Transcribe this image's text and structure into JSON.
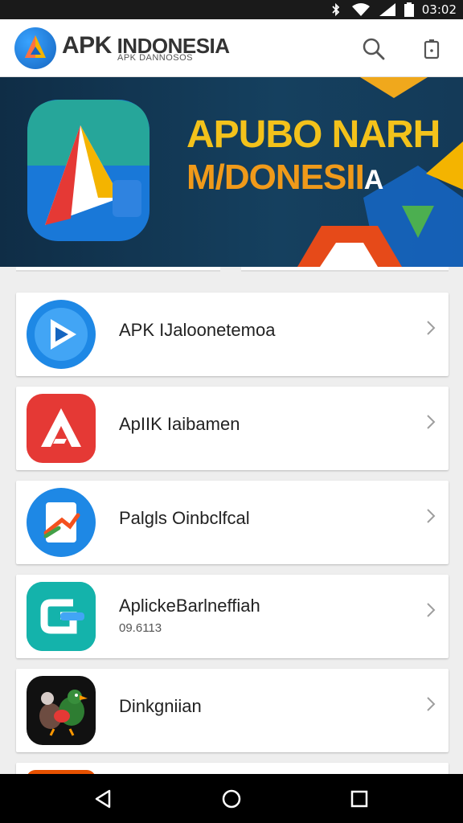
{
  "status_bar": {
    "time": "03:02",
    "icons": [
      "bluetooth-icon",
      "wifi-icon",
      "signal-icon",
      "battery-icon"
    ]
  },
  "app_bar": {
    "brand_prefix": "APK",
    "brand_word": "INDONESIA",
    "brand_sub": "APK DANNOSOS",
    "actions": [
      "search-icon",
      "clipboard-icon"
    ]
  },
  "banner": {
    "line1": "APUBO NARH",
    "line2": "M/DONESII",
    "line2_tail": "A"
  },
  "apps": [
    {
      "title": "APK IJaloonetemoa",
      "subtitle": "",
      "icon": "play-store-style-icon",
      "color": "#1e88e5"
    },
    {
      "title": "ApIIK Iaibamen",
      "subtitle": "",
      "icon": "letter-a-icon",
      "color": "#e53935"
    },
    {
      "title": "Palgls Oinbclfcal",
      "subtitle": "",
      "icon": "document-brush-icon",
      "color": "#1e88e5"
    },
    {
      "title": "AplickeBarlneffiah",
      "subtitle": "09.6113",
      "icon": "letter-g-icon",
      "color": "#00a09a"
    },
    {
      "title": "Dinkgniian",
      "subtitle": "",
      "icon": "bird-icon",
      "color": "#111111"
    }
  ],
  "nav": [
    "back-icon",
    "home-icon",
    "recents-icon"
  ]
}
